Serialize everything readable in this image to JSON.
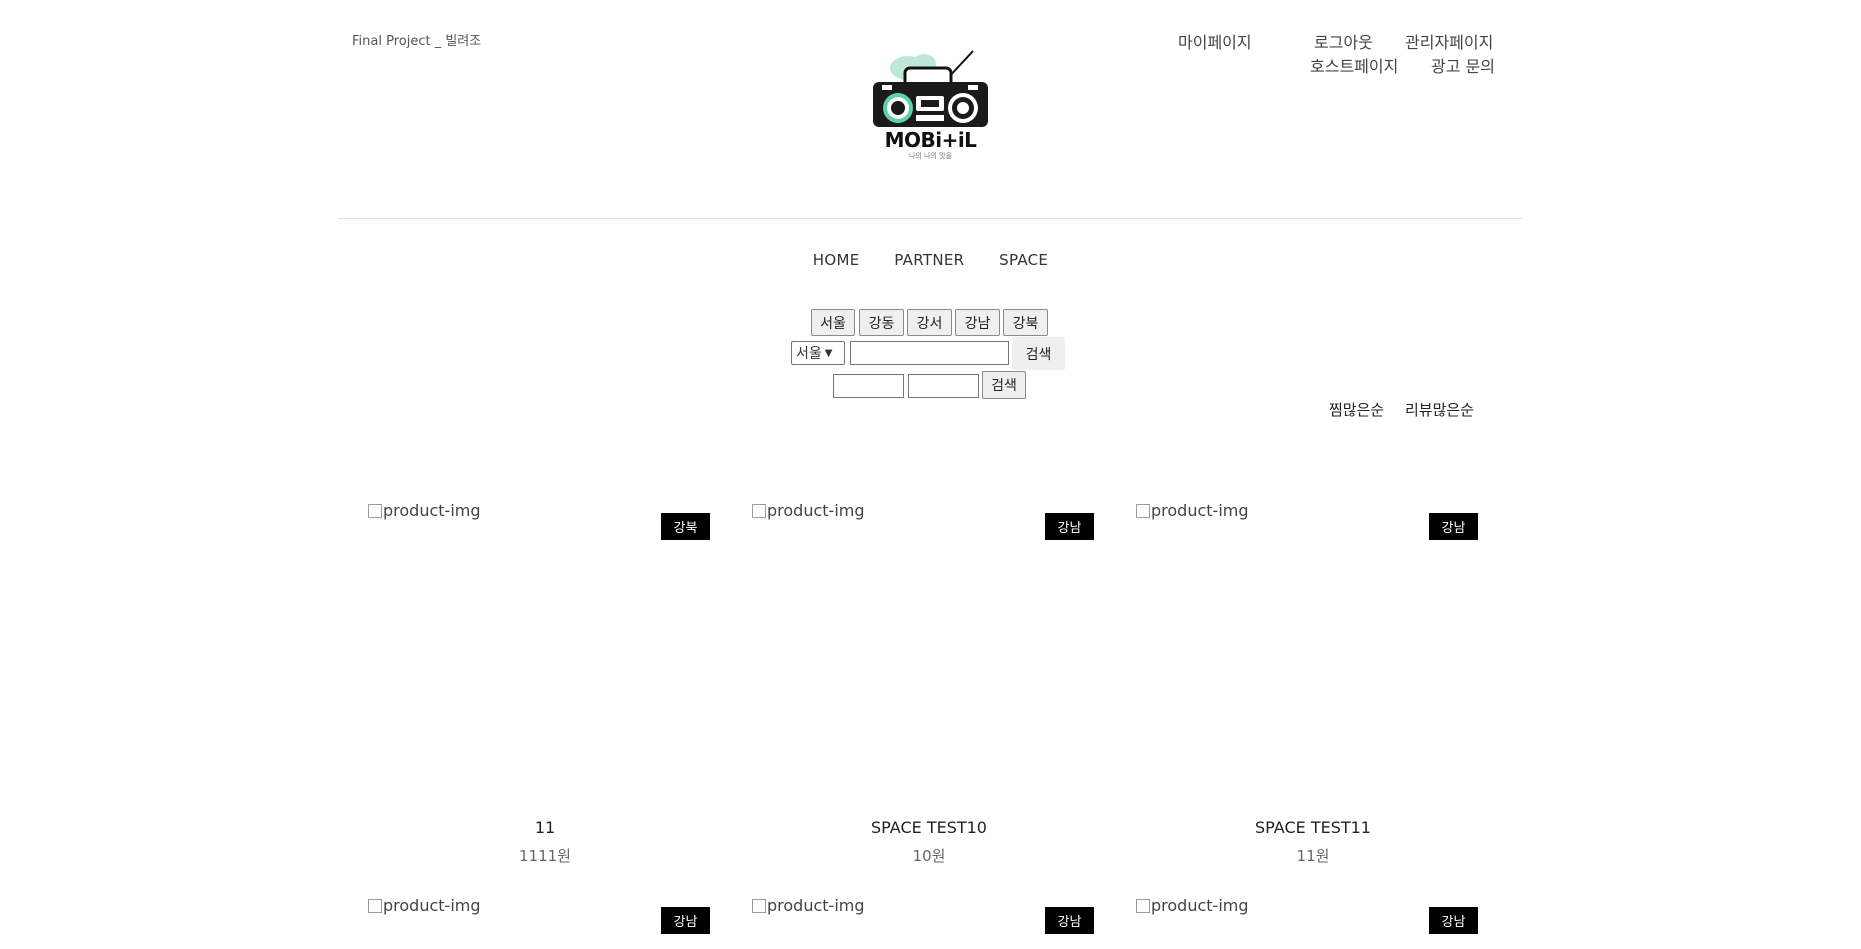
{
  "header": {
    "project_note": "Final Project _ 빌려조",
    "links": {
      "mypage": "마이페이지",
      "logout": "로그아웃",
      "admin": "관리자페이지",
      "host": "호스트페이지",
      "ad": "광고 문의"
    },
    "logo": {
      "brand": "MOBi+iL",
      "tagline": "나의 나의 맛을"
    }
  },
  "nav": {
    "home": "HOME",
    "partner": "PARTNER",
    "space": "SPACE"
  },
  "filters": {
    "regions": [
      "서울",
      "강동",
      "강서",
      "강남",
      "강북"
    ],
    "select_value": "서울",
    "search_label": "검색",
    "search_label2": "검색"
  },
  "sort": {
    "by_likes": "찜많은순",
    "by_reviews": "리뷰많은순"
  },
  "products": [
    {
      "alt": "product-img",
      "badge": "강북",
      "title": "11",
      "price": "1111원"
    },
    {
      "alt": "product-img",
      "badge": "강남",
      "title": "SPACE TEST10",
      "price": "10원"
    },
    {
      "alt": "product-img",
      "badge": "강남",
      "title": "SPACE TEST11",
      "price": "11원"
    },
    {
      "alt": "product-img",
      "badge": "강남"
    },
    {
      "alt": "product-img",
      "badge": "강남"
    },
    {
      "alt": "product-img",
      "badge": "강남"
    }
  ],
  "colors": {
    "accent": "#5bd3a5",
    "badge_bg": "#000000"
  }
}
